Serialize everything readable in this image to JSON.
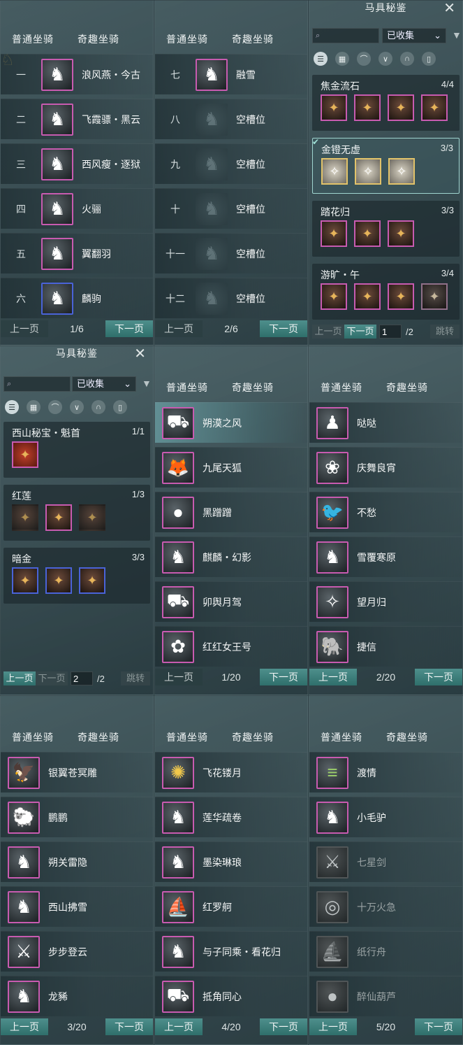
{
  "tabs": {
    "normal": "普通坐骑",
    "special": "奇趣坐骑"
  },
  "pager": {
    "prev": "上一页",
    "next": "下一页"
  },
  "panel1": {
    "rows": [
      {
        "num": "一",
        "name": "浪风燕・今古",
        "icon": "white-horse-icon"
      },
      {
        "num": "二",
        "name": "飞霞骠・黑云",
        "icon": "black-horse-icon"
      },
      {
        "num": "三",
        "name": "西风瘦・逐狱",
        "icon": "black-horse-icon"
      },
      {
        "num": "四",
        "name": "火骊",
        "icon": "brown-horse-icon"
      },
      {
        "num": "五",
        "name": "翼翻羽",
        "icon": "black-horse-icon"
      },
      {
        "num": "六",
        "name": "麟驹",
        "icon": "black-horse-icon"
      }
    ],
    "page": "1/6"
  },
  "panel2": {
    "rows": [
      {
        "num": "七",
        "name": "融雪",
        "icon": "white-horse-icon"
      },
      {
        "num": "八",
        "name": "空槽位",
        "icon": "empty-slot-icon"
      },
      {
        "num": "九",
        "name": "空槽位",
        "icon": "empty-slot-icon"
      },
      {
        "num": "十",
        "name": "空槽位",
        "icon": "empty-slot-icon"
      },
      {
        "num": "十一",
        "name": "空槽位",
        "icon": "empty-slot-icon"
      },
      {
        "num": "十二",
        "name": "空槽位",
        "icon": "empty-slot-icon"
      }
    ],
    "page": "2/6"
  },
  "tujian": {
    "title": "马具秘鉴",
    "filter_value": "已收集",
    "jump": "跳转",
    "total": "/2",
    "a": {
      "page_input": "1",
      "sets": [
        {
          "name": "焦金流石",
          "count": "4/4"
        },
        {
          "name": "金镫无虚",
          "count": "3/3"
        },
        {
          "name": "踏花归",
          "count": "3/3"
        },
        {
          "name": "游旷・午",
          "count": "3/4"
        }
      ]
    },
    "b": {
      "page_input": "2",
      "sets": [
        {
          "name": "西山秘宝・魁首",
          "count": "1/1"
        },
        {
          "name": "红莲",
          "count": "1/3"
        },
        {
          "name": "暗金",
          "count": "3/3"
        }
      ]
    }
  },
  "panel5": {
    "rows": [
      "朔漠之风",
      "九尾天狐",
      "黑蹭蹭",
      "麒麟・幻影",
      "卯舆月驾",
      "红红女王号"
    ],
    "page": "1/20"
  },
  "panel6": {
    "rows": [
      "哒哒",
      "庆舞良宵",
      "不愁",
      "雪覆寒原",
      "望月归",
      "捷信"
    ],
    "page": "2/20"
  },
  "panel7": {
    "rows": [
      "银翼苍冥雕",
      "鹏鹏",
      "朔关雷隐",
      "西山拂雪",
      "步步登云",
      "龙豨"
    ],
    "page": "3/20"
  },
  "panel8": {
    "rows": [
      "飞花镂月",
      "莲华疏卷",
      "墨染琳琅",
      "红罗舸",
      "与子同乘・看花归",
      "抵角同心"
    ],
    "page": "4/20"
  },
  "panel9": {
    "rows": [
      "渡情",
      "小毛驴",
      "七星剑",
      "十万火急",
      "纸行舟",
      "醉仙葫芦"
    ],
    "page": "5/20"
  }
}
